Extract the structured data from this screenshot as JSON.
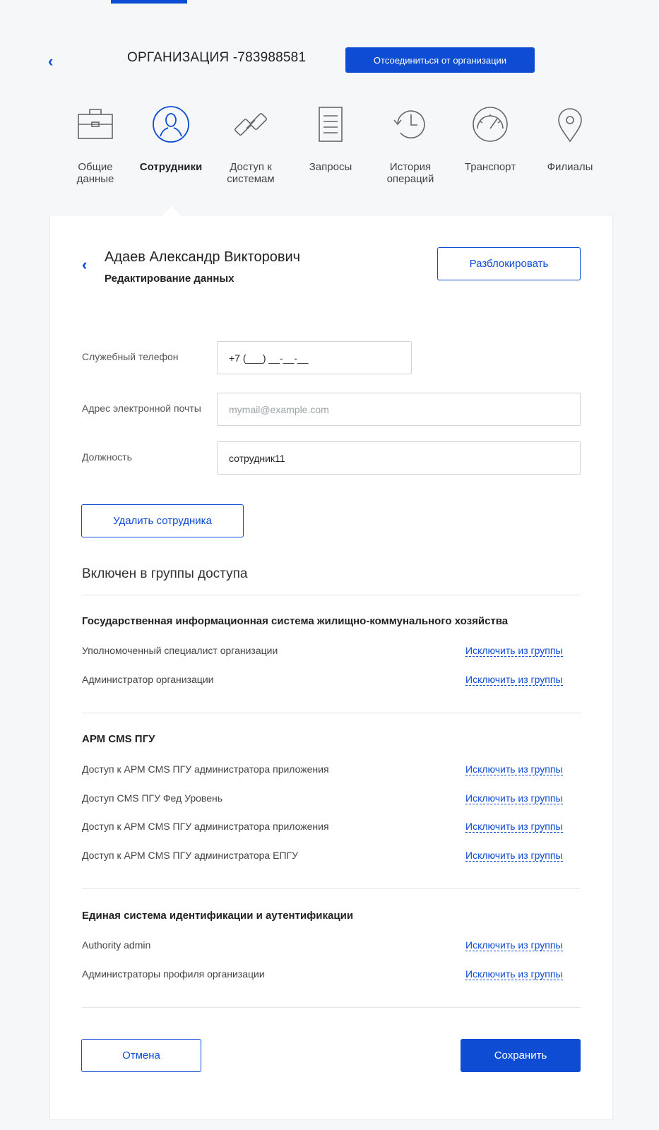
{
  "header": {
    "org_title": "ОРГАНИЗАЦИЯ -783988581",
    "disconnect_label": "Отсоединиться от организации",
    "back_icon": "chevron-left-icon"
  },
  "tabs": [
    {
      "label": "Общие\nданные",
      "icon": "briefcase-icon",
      "active": false
    },
    {
      "label": "Сотрудники",
      "icon": "user-icon",
      "active": true
    },
    {
      "label": "Доступ к\nсистемам",
      "icon": "link-icon",
      "active": false
    },
    {
      "label": "Запросы",
      "icon": "document-icon",
      "active": false
    },
    {
      "label": "История\nопераций",
      "icon": "history-icon",
      "active": false
    },
    {
      "label": "Транспорт",
      "icon": "speedometer-icon",
      "active": false
    },
    {
      "label": "Филиалы",
      "icon": "map-pin-icon",
      "active": false
    }
  ],
  "employee": {
    "name": "Адаев Александр Викторович",
    "subtitle": "Редактирование данных",
    "unblock_label": "Разблокировать"
  },
  "form": {
    "phone_label": "Служебный телефон",
    "phone_value": "+7 (___) __-__-__",
    "email_label": "Адрес электронной почты",
    "email_placeholder": "mymail@example.com",
    "position_label": "Должность",
    "position_value": "сотрудник11"
  },
  "delete_label": "Удалить сотрудника",
  "groups_title": "Включен в группы доступа",
  "exclude_label": "Исключить из группы",
  "groups": [
    {
      "title": "Государственная информационная система жилищно-коммунального хозяйства",
      "roles": [
        "Уполномоченный специалист организации",
        "Администратор организации"
      ]
    },
    {
      "title": "АРМ CMS ПГУ",
      "roles": [
        "Доступ к АРМ CMS ПГУ администратора приложения",
        "Доступ CMS ПГУ Фед Уровень",
        "Доступ к АРМ CMS ПГУ администратора приложения",
        "Доступ к АРМ CMS ПГУ администратора ЕПГУ"
      ]
    },
    {
      "title": "Единая система идентификации и аутентификации",
      "roles": [
        "Authority admin",
        "Администраторы профиля организации"
      ]
    }
  ],
  "footer": {
    "cancel_label": "Отмена",
    "save_label": "Сохранить"
  },
  "colors": {
    "accent": "#0d4cd3",
    "background": "#f5f7f8"
  }
}
